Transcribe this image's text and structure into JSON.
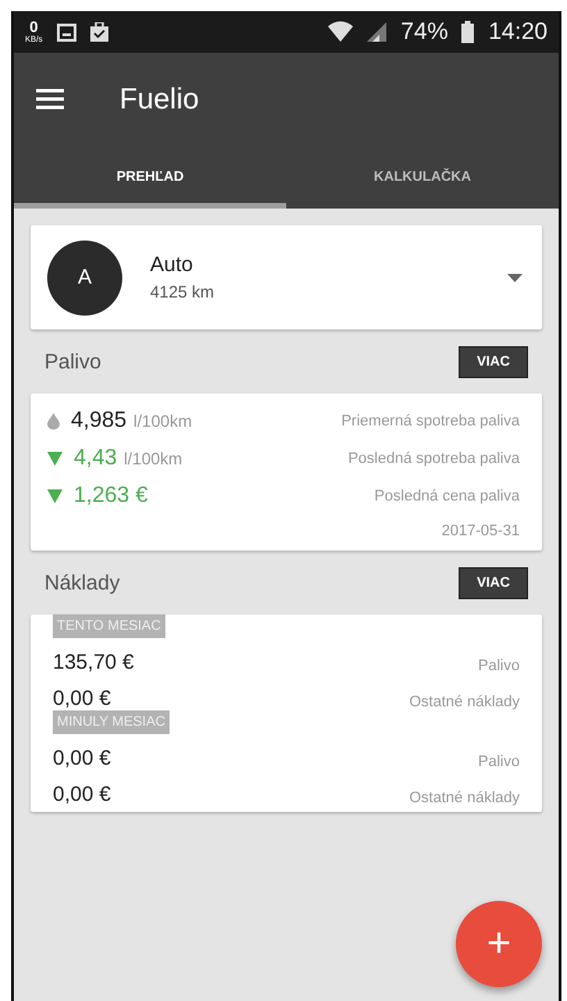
{
  "status_bar": {
    "speed_value": "0",
    "speed_unit": "KB/s",
    "battery": "74%",
    "time": "14:20"
  },
  "app_bar": {
    "title": "Fuelio"
  },
  "tabs": [
    {
      "label": "PREHĽAD",
      "selected": true
    },
    {
      "label": "KALKULAČKA",
      "selected": false
    }
  ],
  "vehicle": {
    "avatar": "A",
    "name": "Auto",
    "odometer": "4125 km"
  },
  "fuel": {
    "title": "Palivo",
    "more": "VIAC",
    "rows": [
      {
        "kind": "average",
        "value": "4,985",
        "unit": "l/100km",
        "label": "Priemerná spotreba paliva"
      },
      {
        "kind": "down",
        "value": "4,43",
        "unit": "l/100km",
        "label": "Posledná spotreba paliva"
      },
      {
        "kind": "down",
        "value": "1,263 €",
        "label": "Posledná cena paliva"
      }
    ],
    "date": "2017-05-31"
  },
  "costs": {
    "title": "Náklady",
    "more": "VIAC",
    "groups": [
      {
        "heading": "TENTO MESIAC",
        "rows": [
          {
            "value": "135,70 €",
            "label": "Palivo"
          },
          {
            "value": "0,00 €",
            "label": "Ostatné náklady"
          }
        ]
      },
      {
        "heading": "MINULY MESIAC",
        "rows": [
          {
            "value": "0,00 €",
            "label": "Palivo"
          },
          {
            "value": "0,00 €",
            "label": "Ostatné náklady"
          }
        ]
      }
    ]
  },
  "fab": {
    "label": "+"
  }
}
